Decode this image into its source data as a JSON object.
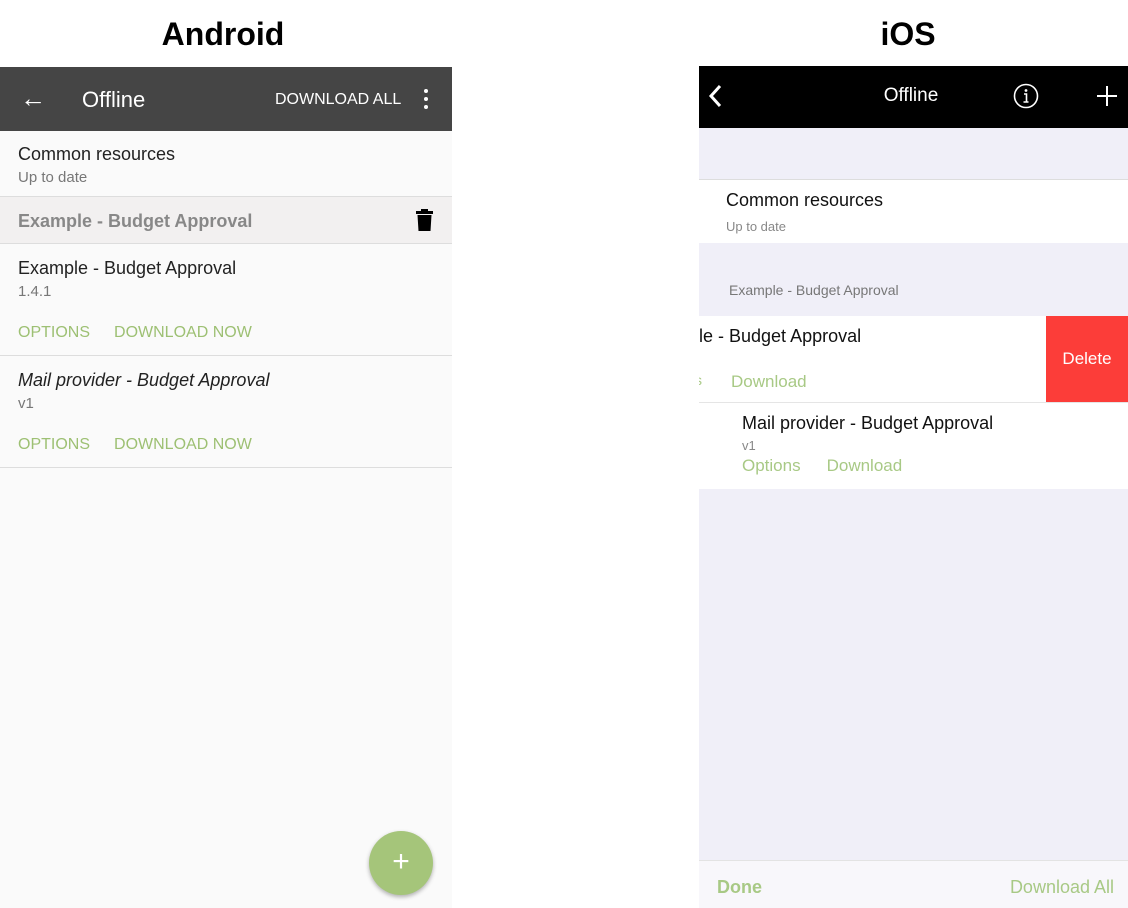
{
  "labels": {
    "android": "Android",
    "ios": "iOS"
  },
  "android": {
    "header": {
      "title": "Offline",
      "download_all": "DOWNLOAD ALL"
    },
    "common": {
      "title": "Common resources",
      "status": "Up to date"
    },
    "section": {
      "title": "Example - Budget Approval"
    },
    "items": [
      {
        "title": "Example - Budget Approval",
        "version": "1.4.1",
        "options": "OPTIONS",
        "download": "DOWNLOAD NOW"
      },
      {
        "title": "Mail provider - Budget Approval",
        "version": "v1",
        "options": "OPTIONS",
        "download": "DOWNLOAD NOW"
      }
    ],
    "fab": "+",
    "accent": "#a5c57a"
  },
  "ios": {
    "header": {
      "title": "Offline"
    },
    "common": {
      "title": "Common resources",
      "status": "Up to date"
    },
    "section": {
      "title": "Example - Budget Approval"
    },
    "swiped": {
      "title": "le - Budget Approval",
      "options_fragment": "s",
      "download": "Download",
      "delete": "Delete"
    },
    "item": {
      "title": "Mail provider - Budget Approval",
      "version": "v1",
      "options": "Options",
      "download": "Download"
    },
    "footer": {
      "done": "Done",
      "download_all": "Download All"
    },
    "delete_color": "#fc3d39"
  }
}
